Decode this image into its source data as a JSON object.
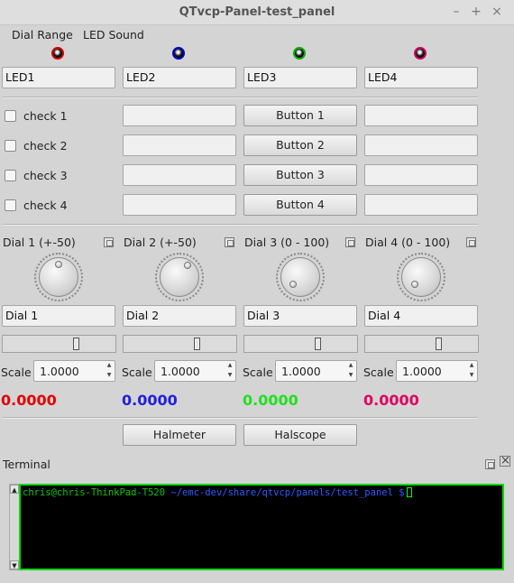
{
  "window": {
    "title": "QTvcp-Panel-test_panel",
    "controls": [
      "–",
      "+",
      "×"
    ]
  },
  "menu": [
    "Dial Range",
    "LED Sound"
  ],
  "leds": [
    {
      "field": "LED1",
      "color": "#d00000"
    },
    {
      "field": "LED2",
      "color": "#0000c0"
    },
    {
      "field": "LED3",
      "color": "#00b000"
    },
    {
      "field": "LED4",
      "color": "#d00060"
    }
  ],
  "checks": [
    "check 1",
    "check 2",
    "check 3",
    "check 4"
  ],
  "buttons": [
    "Button 1",
    "Button 2",
    "Button 3",
    "Button 4"
  ],
  "dials": [
    {
      "title": "Dial 1 (+-50)",
      "field": "Dial 1",
      "scale_label": "Scale",
      "scale": "1.0000",
      "value": "0.0000",
      "color": "#e00000"
    },
    {
      "title": "Dial 2 (+-50)",
      "field": "Dial 2",
      "scale_label": "Scale",
      "scale": "1.0000",
      "value": "0.0000",
      "color": "#2020e0"
    },
    {
      "title": "Dial 3 (0 - 100)",
      "field": "Dial 3",
      "scale_label": "Scale",
      "scale": "1.0000",
      "value": "0.0000",
      "color": "#20e020"
    },
    {
      "title": "Dial 4 (0 - 100)",
      "field": "Dial 4",
      "scale_label": "Scale",
      "scale": "1.0000",
      "value": "0.0000",
      "color": "#e00060"
    }
  ],
  "tools": {
    "halmeter": "Halmeter",
    "halscope": "Halscope"
  },
  "terminal": {
    "title": "Terminal",
    "user": "chris@chris-ThinkPad-T520",
    "path": "~/emc-dev/share/qtvcp/panels/test_panel $",
    "user_color": "#00c800",
    "path_color": "#2b5cff"
  }
}
